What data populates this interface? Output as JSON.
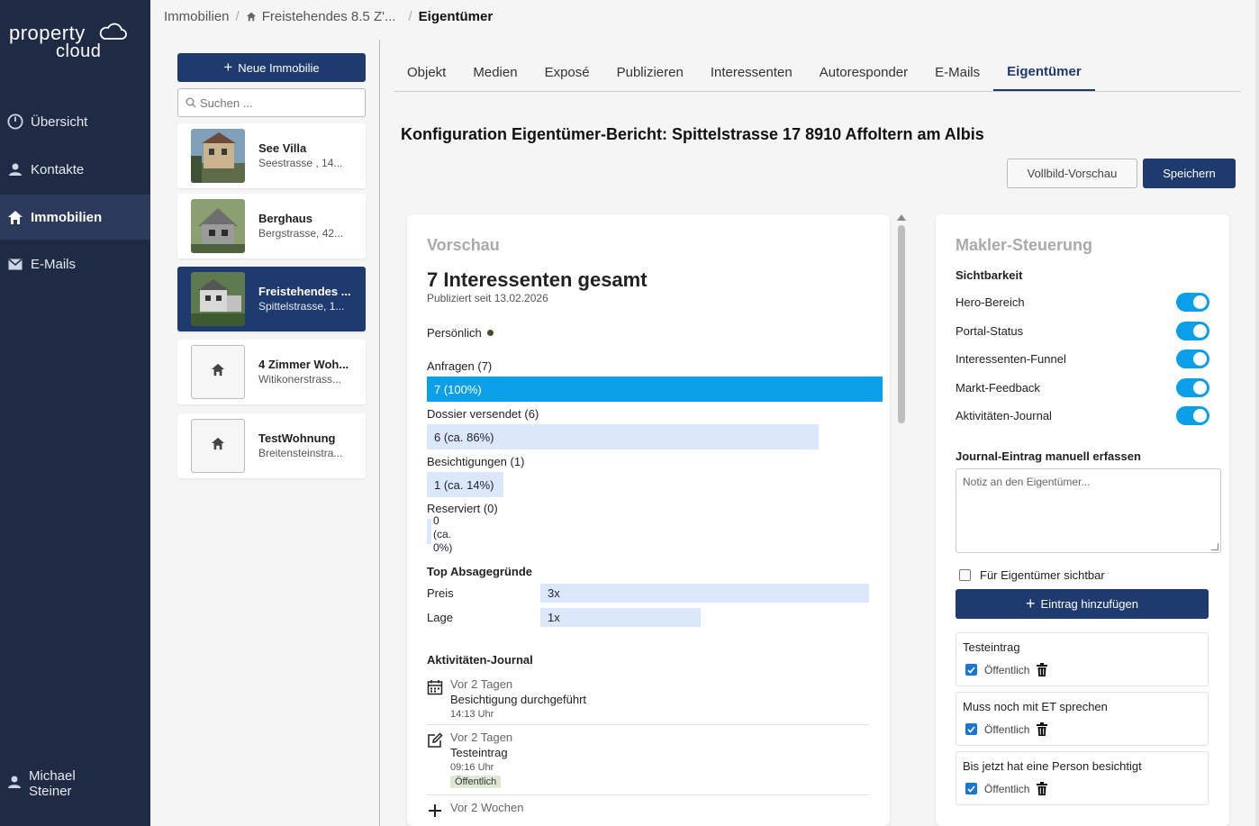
{
  "brand": {
    "line1": "property",
    "line2": "cloud"
  },
  "nav": {
    "items": [
      {
        "label": "Übersicht",
        "icon": "gauge-icon"
      },
      {
        "label": "Kontakte",
        "icon": "person-icon"
      },
      {
        "label": "Immobilien",
        "icon": "home-icon",
        "active": true
      },
      {
        "label": "E-Mails",
        "icon": "mail-icon"
      }
    ],
    "user": {
      "first": "Michael",
      "last": "Steiner"
    }
  },
  "breadcrumb": {
    "root": "Immobilien",
    "property": "Freistehendes 8.5 Z'...",
    "current": "Eigentümer"
  },
  "list": {
    "new_button": "Neue Immobilie",
    "search_placeholder": "Suchen ...",
    "properties": [
      {
        "name": "See Villa",
        "address": "Seestrasse , 14...",
        "has_photo": true
      },
      {
        "name": "Berghaus",
        "address": "Bergstrasse, 42...",
        "has_photo": true
      },
      {
        "name": "Freistehendes ...",
        "address": "Spittelstrasse, 1...",
        "has_photo": true,
        "active": true
      },
      {
        "name": "4 Zimmer Woh...",
        "address": "Witikonerstrass...",
        "has_photo": false
      },
      {
        "name": "TestWohnung",
        "address": "Breitensteinstra...",
        "has_photo": false
      }
    ]
  },
  "tabs": [
    "Objekt",
    "Medien",
    "Exposé",
    "Publizieren",
    "Interessenten",
    "Autoresponder",
    "E-Mails",
    "Eigentümer"
  ],
  "active_tab": "Eigentümer",
  "page": {
    "title": "Konfiguration Eigentümer-Bericht: Spittelstrasse 17 8910 Affoltern am Albis",
    "preview_button": "Vollbild-Vorschau",
    "save_button": "Speichern"
  },
  "preview": {
    "heading": "Vorschau",
    "total": "7 Interessenten gesamt",
    "published": "Publiziert seit 13.02.2026",
    "personal": "Persönlich",
    "funnel": [
      {
        "label": "Anfragen (7)",
        "bar": "7 (100%)",
        "value": 7,
        "percent": 100
      },
      {
        "label": "Dossier versendet (6)",
        "bar": "6 (ca. 86%)",
        "value": 6,
        "percent": 86
      },
      {
        "label": "Besichtigungen (1)",
        "bar": "1 (ca. 14%)",
        "value": 1,
        "percent": 14
      },
      {
        "label": "Reserviert (0)",
        "bar": "0 (ca. 0%)",
        "value": 0,
        "percent": 0
      }
    ],
    "reasons_heading": "Top Absagegründe",
    "reasons": [
      {
        "label": "Preis",
        "count": "3x",
        "value": 3
      },
      {
        "label": "Lage",
        "count": "1x",
        "value": 1
      }
    ],
    "journal_heading": "Aktivitäten-Journal",
    "journal": [
      {
        "when": "Vor 2 Tagen",
        "what": "Besichtigung durchgeführt",
        "time": "14:13 Uhr",
        "icon": "calendar-icon"
      },
      {
        "when": "Vor 2 Tagen",
        "what": "Testeintrag",
        "time": "09:16 Uhr",
        "badge": "Öffentlich",
        "icon": "edit-icon"
      },
      {
        "when": "Vor 2 Wochen",
        "icon": "plus-icon"
      }
    ]
  },
  "control": {
    "heading": "Makler-Steuerung",
    "visibility_heading": "Sichtbarkeit",
    "toggles": [
      {
        "label": "Hero-Bereich",
        "on": true
      },
      {
        "label": "Portal-Status",
        "on": true
      },
      {
        "label": "Interessenten-Funnel",
        "on": true
      },
      {
        "label": "Markt-Feedback",
        "on": true
      },
      {
        "label": "Aktivitäten-Journal",
        "on": true
      }
    ],
    "journal_heading": "Journal-Eintrag manuell erfassen",
    "note_placeholder": "Notiz an den Eigentümer...",
    "visible_checkbox": "Für Eigentümer sichtbar",
    "add_button": "Eintrag hinzufügen",
    "entries": [
      {
        "text": "Testeintrag",
        "public": "Öffentlich"
      },
      {
        "text": "Muss noch mit ET sprechen",
        "public": "Öffentlich"
      },
      {
        "text": "Bis jetzt hat eine Person besichtigt",
        "public": "Öffentlich"
      }
    ]
  },
  "colors": {
    "sidebar": "#1f2a44",
    "primary": "#1f3a6e",
    "accent": "#0b9fe8",
    "bar_light": "#dbe7fb"
  }
}
